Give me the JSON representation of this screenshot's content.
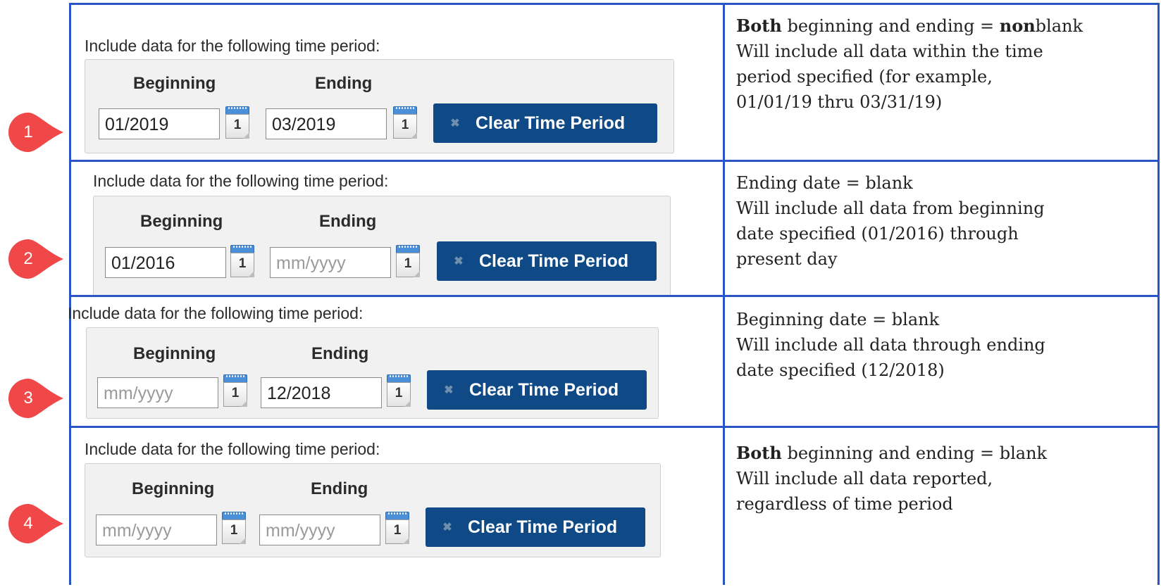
{
  "rows": [
    {
      "marker": "1",
      "label": "Include data for the following time period:",
      "beginning_label": "Beginning",
      "ending_label": "Ending",
      "beginning_value": "01/2019",
      "beginning_placeholder": "",
      "ending_value": "03/2019",
      "ending_placeholder": "",
      "calendar_day": "1",
      "clear_button": "Clear Time Period",
      "desc_bold": "Both",
      "desc_line1_a": " beginning and ending = ",
      "desc_line1_b": "non",
      "desc_line1_c": "blank",
      "desc_lines": [
        "Will include all data within the time",
        "period specified (for example,",
        "01/01/19 thru 03/31/19)"
      ]
    },
    {
      "marker": "2",
      "label": "Include data for the following time period:",
      "beginning_label": "Beginning",
      "ending_label": "Ending",
      "beginning_value": "01/2016",
      "beginning_placeholder": "",
      "ending_value": "",
      "ending_placeholder": "mm/yyyy",
      "calendar_day": "1",
      "clear_button": "Clear Time Period",
      "desc_lines": [
        "Ending date = blank",
        "Will include all data from beginning",
        "date specified (01/2016) through",
        "present day"
      ]
    },
    {
      "marker": "3",
      "label": "Include data for the following time period:",
      "beginning_label": "Beginning",
      "ending_label": "Ending",
      "beginning_value": "",
      "beginning_placeholder": "mm/yyyy",
      "ending_value": "12/2018",
      "ending_placeholder": "",
      "calendar_day": "1",
      "clear_button": "Clear Time Period",
      "desc_lines": [
        "Beginning date = blank",
        "Will include all data through ending",
        "date specified (12/2018)"
      ]
    },
    {
      "marker": "4",
      "label": "Include data for the following time period:",
      "beginning_label": "Beginning",
      "ending_label": "Ending",
      "beginning_value": "",
      "beginning_placeholder": "mm/yyyy",
      "ending_value": "",
      "ending_placeholder": "mm/yyyy",
      "calendar_day": "1",
      "clear_button": "Clear Time Period",
      "desc_bold": "Both",
      "desc_line1_a": " beginning and ending = blank",
      "desc_lines": [
        "Will include all data reported,",
        "regardless of time period"
      ]
    }
  ],
  "colors": {
    "grid_border": "#2a55c4",
    "button_bg": "#0f4a86",
    "marker_red": "#f04848",
    "panel_bg": "#f1f1f1"
  }
}
